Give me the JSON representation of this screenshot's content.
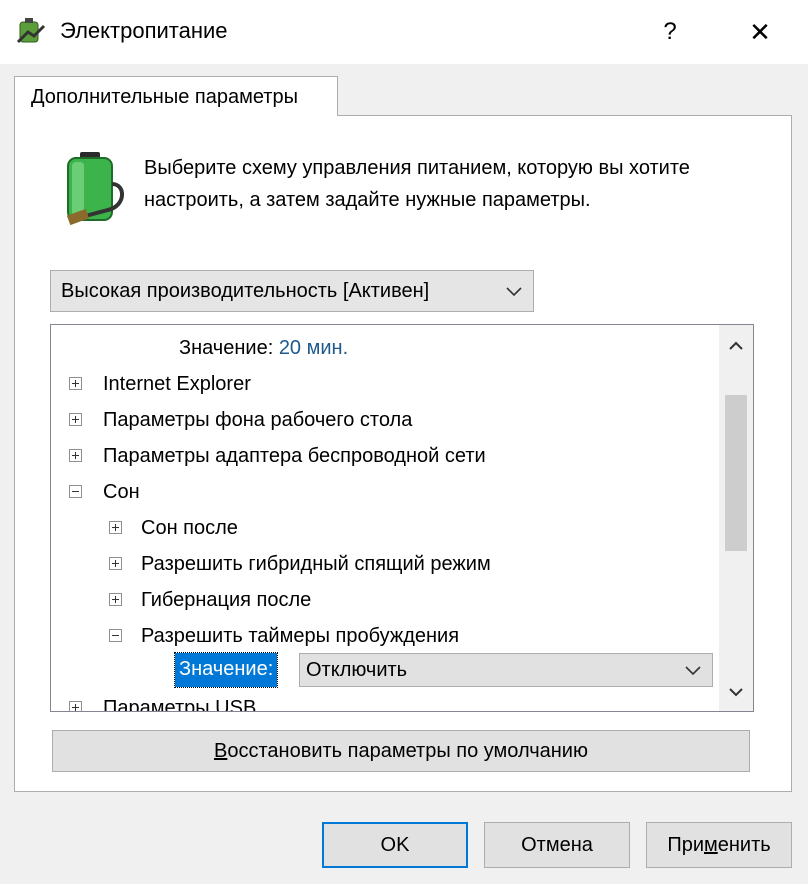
{
  "window": {
    "title": "Электропитание",
    "help_label": "?",
    "close_label": "✕"
  },
  "tab": {
    "label": "Дополнительные параметры"
  },
  "description": "Выберите схему управления питанием, которую вы хотите настроить, а затем задайте нужные параметры.",
  "plan_select": {
    "value": "Высокая производительность [Активен]"
  },
  "tree": {
    "top_value_label": "Значение:",
    "top_value": "20 мин.",
    "items": [
      {
        "label": "Internet Explorer",
        "expanded": false
      },
      {
        "label": "Параметры фона рабочего стола",
        "expanded": false
      },
      {
        "label": "Параметры адаптера беспроводной сети",
        "expanded": false
      },
      {
        "label": "Сон",
        "expanded": true
      },
      {
        "label": "Сон после",
        "expanded": false
      },
      {
        "label": "Разрешить гибридный спящий режим",
        "expanded": false
      },
      {
        "label": "Гибернация после",
        "expanded": false
      },
      {
        "label": "Разрешить таймеры пробуждения",
        "expanded": true
      },
      {
        "label": "Параметры USB",
        "expanded": false
      }
    ],
    "value_label": "Значение:",
    "value_select": "Отключить"
  },
  "buttons": {
    "restore_first": "В",
    "restore_rest": "осстановить параметры по умолчанию",
    "ok": "OK",
    "cancel": "Отмена",
    "apply_pre": "При",
    "apply_ul": "м",
    "apply_post": "енить"
  },
  "colors": {
    "accent": "#0078d7",
    "value_text": "#1e5a8c",
    "battery": "#3cb44b"
  }
}
